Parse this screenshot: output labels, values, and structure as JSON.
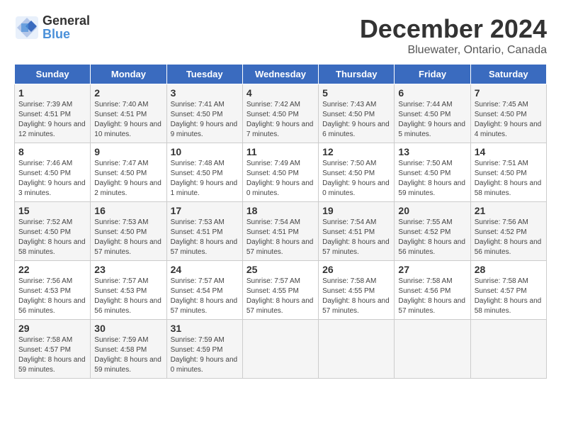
{
  "header": {
    "logo_general": "General",
    "logo_blue": "Blue",
    "title": "December 2024",
    "subtitle": "Bluewater, Ontario, Canada"
  },
  "calendar": {
    "weekdays": [
      "Sunday",
      "Monday",
      "Tuesday",
      "Wednesday",
      "Thursday",
      "Friday",
      "Saturday"
    ],
    "weeks": [
      [
        {
          "day": "1",
          "sunrise": "7:39 AM",
          "sunset": "4:51 PM",
          "daylight": "9 hours and 12 minutes."
        },
        {
          "day": "2",
          "sunrise": "7:40 AM",
          "sunset": "4:51 PM",
          "daylight": "9 hours and 10 minutes."
        },
        {
          "day": "3",
          "sunrise": "7:41 AM",
          "sunset": "4:50 PM",
          "daylight": "9 hours and 9 minutes."
        },
        {
          "day": "4",
          "sunrise": "7:42 AM",
          "sunset": "4:50 PM",
          "daylight": "9 hours and 7 minutes."
        },
        {
          "day": "5",
          "sunrise": "7:43 AM",
          "sunset": "4:50 PM",
          "daylight": "9 hours and 6 minutes."
        },
        {
          "day": "6",
          "sunrise": "7:44 AM",
          "sunset": "4:50 PM",
          "daylight": "9 hours and 5 minutes."
        },
        {
          "day": "7",
          "sunrise": "7:45 AM",
          "sunset": "4:50 PM",
          "daylight": "9 hours and 4 minutes."
        }
      ],
      [
        {
          "day": "8",
          "sunrise": "7:46 AM",
          "sunset": "4:50 PM",
          "daylight": "9 hours and 3 minutes."
        },
        {
          "day": "9",
          "sunrise": "7:47 AM",
          "sunset": "4:50 PM",
          "daylight": "9 hours and 2 minutes."
        },
        {
          "day": "10",
          "sunrise": "7:48 AM",
          "sunset": "4:50 PM",
          "daylight": "9 hours and 1 minute."
        },
        {
          "day": "11",
          "sunrise": "7:49 AM",
          "sunset": "4:50 PM",
          "daylight": "9 hours and 0 minutes."
        },
        {
          "day": "12",
          "sunrise": "7:50 AM",
          "sunset": "4:50 PM",
          "daylight": "9 hours and 0 minutes."
        },
        {
          "day": "13",
          "sunrise": "7:50 AM",
          "sunset": "4:50 PM",
          "daylight": "8 hours and 59 minutes."
        },
        {
          "day": "14",
          "sunrise": "7:51 AM",
          "sunset": "4:50 PM",
          "daylight": "8 hours and 58 minutes."
        }
      ],
      [
        {
          "day": "15",
          "sunrise": "7:52 AM",
          "sunset": "4:50 PM",
          "daylight": "8 hours and 58 minutes."
        },
        {
          "day": "16",
          "sunrise": "7:53 AM",
          "sunset": "4:50 PM",
          "daylight": "8 hours and 57 minutes."
        },
        {
          "day": "17",
          "sunrise": "7:53 AM",
          "sunset": "4:51 PM",
          "daylight": "8 hours and 57 minutes."
        },
        {
          "day": "18",
          "sunrise": "7:54 AM",
          "sunset": "4:51 PM",
          "daylight": "8 hours and 57 minutes."
        },
        {
          "day": "19",
          "sunrise": "7:54 AM",
          "sunset": "4:51 PM",
          "daylight": "8 hours and 57 minutes."
        },
        {
          "day": "20",
          "sunrise": "7:55 AM",
          "sunset": "4:52 PM",
          "daylight": "8 hours and 56 minutes."
        },
        {
          "day": "21",
          "sunrise": "7:56 AM",
          "sunset": "4:52 PM",
          "daylight": "8 hours and 56 minutes."
        }
      ],
      [
        {
          "day": "22",
          "sunrise": "7:56 AM",
          "sunset": "4:53 PM",
          "daylight": "8 hours and 56 minutes."
        },
        {
          "day": "23",
          "sunrise": "7:57 AM",
          "sunset": "4:53 PM",
          "daylight": "8 hours and 56 minutes."
        },
        {
          "day": "24",
          "sunrise": "7:57 AM",
          "sunset": "4:54 PM",
          "daylight": "8 hours and 57 minutes."
        },
        {
          "day": "25",
          "sunrise": "7:57 AM",
          "sunset": "4:55 PM",
          "daylight": "8 hours and 57 minutes."
        },
        {
          "day": "26",
          "sunrise": "7:58 AM",
          "sunset": "4:55 PM",
          "daylight": "8 hours and 57 minutes."
        },
        {
          "day": "27",
          "sunrise": "7:58 AM",
          "sunset": "4:56 PM",
          "daylight": "8 hours and 57 minutes."
        },
        {
          "day": "28",
          "sunrise": "7:58 AM",
          "sunset": "4:57 PM",
          "daylight": "8 hours and 58 minutes."
        }
      ],
      [
        {
          "day": "29",
          "sunrise": "7:58 AM",
          "sunset": "4:57 PM",
          "daylight": "8 hours and 59 minutes."
        },
        {
          "day": "30",
          "sunrise": "7:59 AM",
          "sunset": "4:58 PM",
          "daylight": "8 hours and 59 minutes."
        },
        {
          "day": "31",
          "sunrise": "7:59 AM",
          "sunset": "4:59 PM",
          "daylight": "9 hours and 0 minutes."
        },
        null,
        null,
        null,
        null
      ]
    ]
  }
}
